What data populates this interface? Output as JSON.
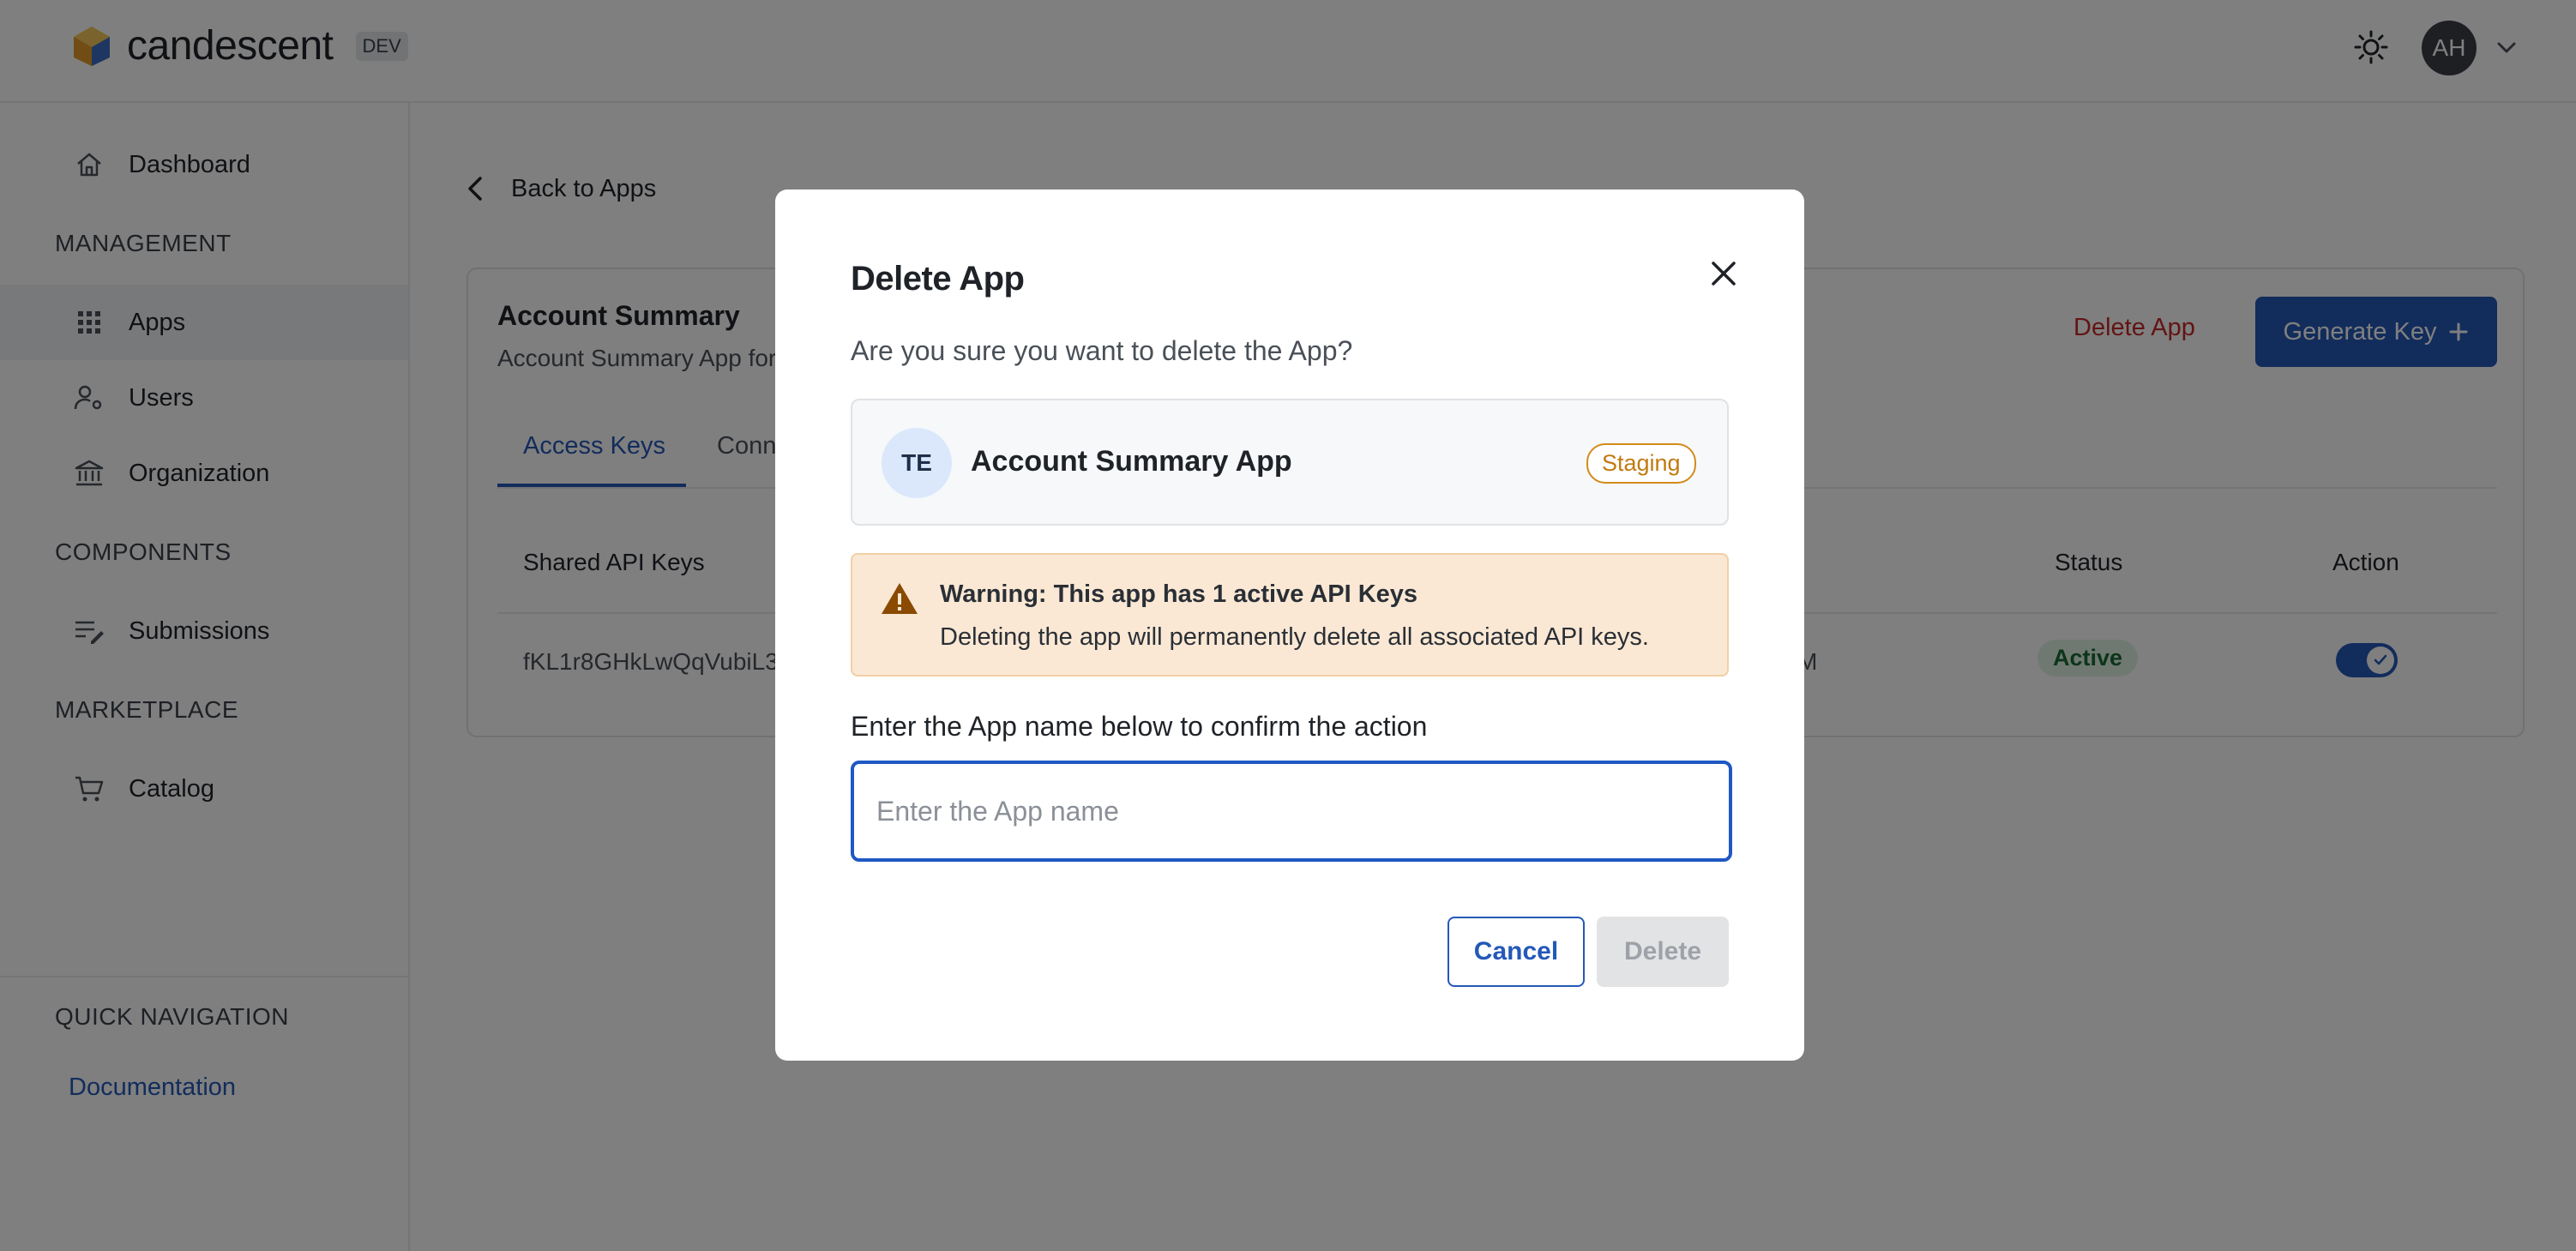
{
  "header": {
    "brand": "candescent",
    "env_badge": "DEV",
    "avatar_initials": "AH",
    "icons": {
      "theme": "sun-icon",
      "menu": "chevron-down-icon"
    }
  },
  "sidebar": {
    "dashboard": "Dashboard",
    "sections": {
      "management": "MANAGEMENT",
      "components": "COMPONENTS",
      "marketplace": "MARKETPLACE",
      "quick_navigation": "QUICK NAVIGATION"
    },
    "items": {
      "apps": "Apps",
      "users": "Users",
      "organization": "Organization",
      "submissions": "Submissions",
      "catalog": "Catalog"
    },
    "active_item": "Apps",
    "documentation": "Documentation"
  },
  "main": {
    "back_link": "Back to Apps",
    "card": {
      "title": "Account Summary",
      "subtitle": "Account Summary App for",
      "delete_button": "Delete App",
      "generate_button": "Generate Key",
      "tabs": [
        "Access Keys",
        "Conn"
      ],
      "columns": {
        "shared_keys": "Shared API Keys",
        "status": "Status",
        "action": "Action"
      },
      "row": {
        "key": "fKL1r8GHkLwQqVubiL3",
        "time_fragment": "M",
        "status": "Active"
      }
    }
  },
  "modal": {
    "title": "Delete App",
    "question": "Are you sure you want to delete the App?",
    "app": {
      "initials": "TE",
      "name": "Account Summary App",
      "environment": "Staging"
    },
    "warning": {
      "title": "Warning: This app has 1 active API Keys",
      "text": "Deleting the app will permanently delete all associated API keys."
    },
    "confirm_label": "Enter the App name below to confirm the action",
    "input": {
      "placeholder": "Enter the App name",
      "value": ""
    },
    "cancel": "Cancel",
    "delete": "Delete"
  },
  "colors": {
    "primary": "#2458b8",
    "danger": "#c62828",
    "warning_bg": "#fae8d4",
    "staging": "#c27a10",
    "active_status": "#1b6b34"
  }
}
